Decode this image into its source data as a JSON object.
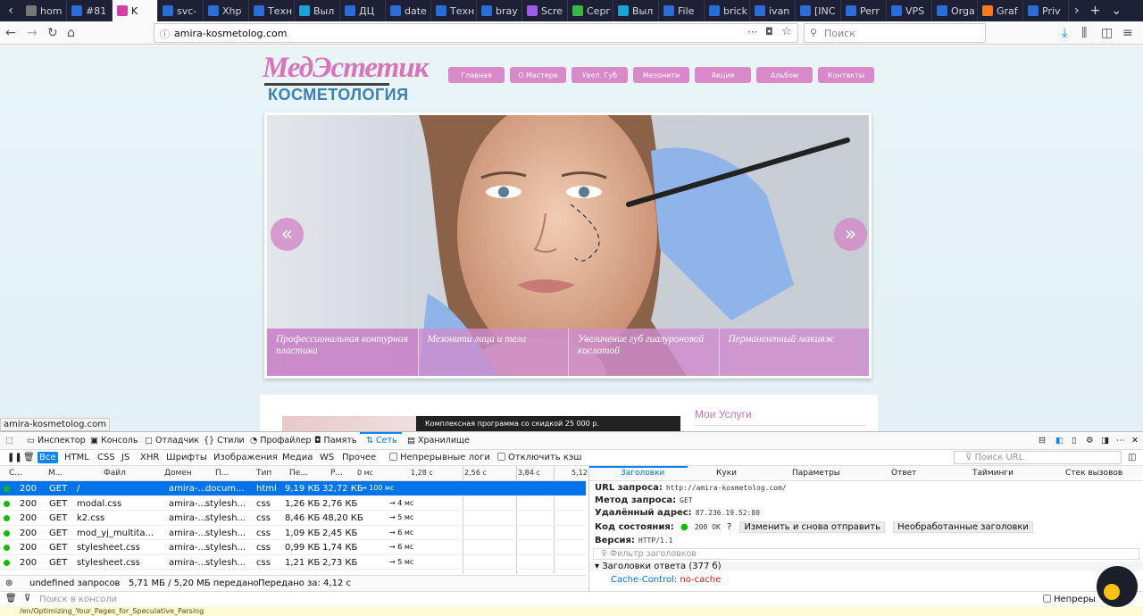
{
  "tabs": [
    {
      "label": "hom",
      "color": "#777"
    },
    {
      "label": "#81",
      "color": "#2a6dd8"
    },
    {
      "label": "K",
      "color": "#d43fa5",
      "active": true
    },
    {
      "label": "svc-",
      "color": "#2a6dd8"
    },
    {
      "label": "Xhp",
      "color": "#2a6dd8"
    },
    {
      "label": "Техн",
      "color": "#2a6dd8"
    },
    {
      "label": "Выл",
      "color": "#1ca1d8"
    },
    {
      "label": "ДЦ",
      "color": "#2a6dd8"
    },
    {
      "label": "date",
      "color": "#2a6dd8"
    },
    {
      "label": "Техн",
      "color": "#2a6dd8"
    },
    {
      "label": "bray",
      "color": "#2a6dd8"
    },
    {
      "label": "Scre",
      "color": "#9b5de5"
    },
    {
      "label": "Серг",
      "color": "#3bb54a"
    },
    {
      "label": "Выл",
      "color": "#1ca1d8"
    },
    {
      "label": "File",
      "color": "#2a6dd8"
    },
    {
      "label": "brick",
      "color": "#2a6dd8"
    },
    {
      "label": "ivan",
      "color": "#2a6dd8"
    },
    {
      "label": "[INC",
      "color": "#2a6dd8"
    },
    {
      "label": "Perr",
      "color": "#2a6dd8"
    },
    {
      "label": "VPS",
      "color": "#2a6dd8"
    },
    {
      "label": "Orga",
      "color": "#2a6dd8"
    },
    {
      "label": "Graf",
      "color": "#f47b20"
    },
    {
      "label": "Priv",
      "color": "#2a6dd8"
    }
  ],
  "navbar": {
    "url": "amira-kosmetolog.com",
    "search_placeholder": "Поиск"
  },
  "site": {
    "logo_top": "МедЭстетик",
    "logo_bottom": "КОСМЕТОЛОГИЯ",
    "menu": [
      "Главная",
      "О Мастере",
      "Увел. Губ",
      "Мезонити",
      "Акция",
      "Альбом",
      "Контакты"
    ],
    "slider_prev": "«",
    "slider_next": "»",
    "captions": [
      "Профессиональная контурная пластика",
      "Мезонити лица и тела",
      "Увеличение губ гиалуроновой кислотой",
      "Перманентный макияж"
    ],
    "promo_text": "Комплексная программа со скидкой 25 000 р.",
    "services_title": "Мои Услуги",
    "accent_color": "#d989c9",
    "status_link": "amira-kosmetolog.com"
  },
  "devtools": {
    "tabs": [
      "Инспектор",
      "Консоль",
      "Отладчик",
      "Стили",
      "Профайлер",
      "Память",
      "Сеть",
      "Хранилище"
    ],
    "selected_tab": "Сеть",
    "filters": [
      "Все",
      "HTML",
      "CSS",
      "JS",
      "XHR",
      "Шрифты",
      "Изображения",
      "Медиа",
      "WS",
      "Прочее"
    ],
    "persist_logs": "Непрерывные логи",
    "disable_cache": "Отключить кэш",
    "url_filter_placeholder": "Поиск URL",
    "columns": [
      "С...",
      "М...",
      "Файл",
      "Домен",
      "П...",
      "Тип",
      "Пе...",
      "Р..."
    ],
    "ticks": [
      "0 мс",
      "1,28 с",
      "2,56 с",
      "3,84 с",
      "5,12"
    ],
    "requests": [
      {
        "status": "200",
        "method": "GET",
        "file": "/",
        "domain": "amira-...",
        "cause": "docum...",
        "type": "html",
        "transferred": "9,19 КБ",
        "size": "32,72 КБ",
        "timing": "→ 100 мс"
      },
      {
        "status": "200",
        "method": "GET",
        "file": "modal.css",
        "domain": "amira-...",
        "cause": "stylesh...",
        "type": "css",
        "transferred": "1,26 КБ",
        "size": "2,76 КБ",
        "timing": "→ 4 мс"
      },
      {
        "status": "200",
        "method": "GET",
        "file": "k2.css",
        "domain": "amira-...",
        "cause": "stylesh...",
        "type": "css",
        "transferred": "8,46 КБ",
        "size": "48,20 КБ",
        "timing": "→ 5 мс"
      },
      {
        "status": "200",
        "method": "GET",
        "file": "mod_yj_multita...",
        "domain": "amira-...",
        "cause": "stylesh...",
        "type": "css",
        "transferred": "1,09 КБ",
        "size": "2,45 КБ",
        "timing": "→ 6 мс"
      },
      {
        "status": "200",
        "method": "GET",
        "file": "stylesheet.css",
        "domain": "amira-...",
        "cause": "stylesh...",
        "type": "css",
        "transferred": "0,99 КБ",
        "size": "1,74 КБ",
        "timing": "→ 6 мс"
      },
      {
        "status": "200",
        "method": "GET",
        "file": "stylesheet.css",
        "domain": "amira-...",
        "cause": "stylesh...",
        "type": "css",
        "transferred": "1,21 КБ",
        "size": "2,73 КБ",
        "timing": "→ 5 мс"
      }
    ],
    "summary": {
      "requests": "undefined запросов",
      "transferred": "5,71 МБ / 5,20 МБ передано",
      "time": "Передано за: 4,12 с"
    },
    "detail_tabs": [
      "Заголовки",
      "Куки",
      "Параметры",
      "Ответ",
      "Тайминги",
      "Стек вызовов"
    ],
    "headers": {
      "url_label": "URL запроса:",
      "url_value": "http://amira-kosmetolog.com/",
      "method_label": "Метод запроса:",
      "method_value": "GET",
      "remote_label": "Удалённый адрес:",
      "remote_value": "87.236.19.52:80",
      "status_label": "Код состояния:",
      "status_value": "200 OK",
      "resend_button": "Изменить и снова отправить",
      "raw_button": "Необработанные заголовки",
      "version_label": "Версия:",
      "version_value": "HTTP/1.1",
      "filter_placeholder": "Фильтр заголовков",
      "response_headers": "Заголовки ответа (377 б)",
      "cache_key": "Cache-Control:",
      "cache_value": "no-cache"
    },
    "console_placeholder": "Поиск в консоли",
    "console_persist": "Непреры",
    "console_note": "/en/Optimizing_Your_Pages_for_Speculative_Parsing"
  }
}
